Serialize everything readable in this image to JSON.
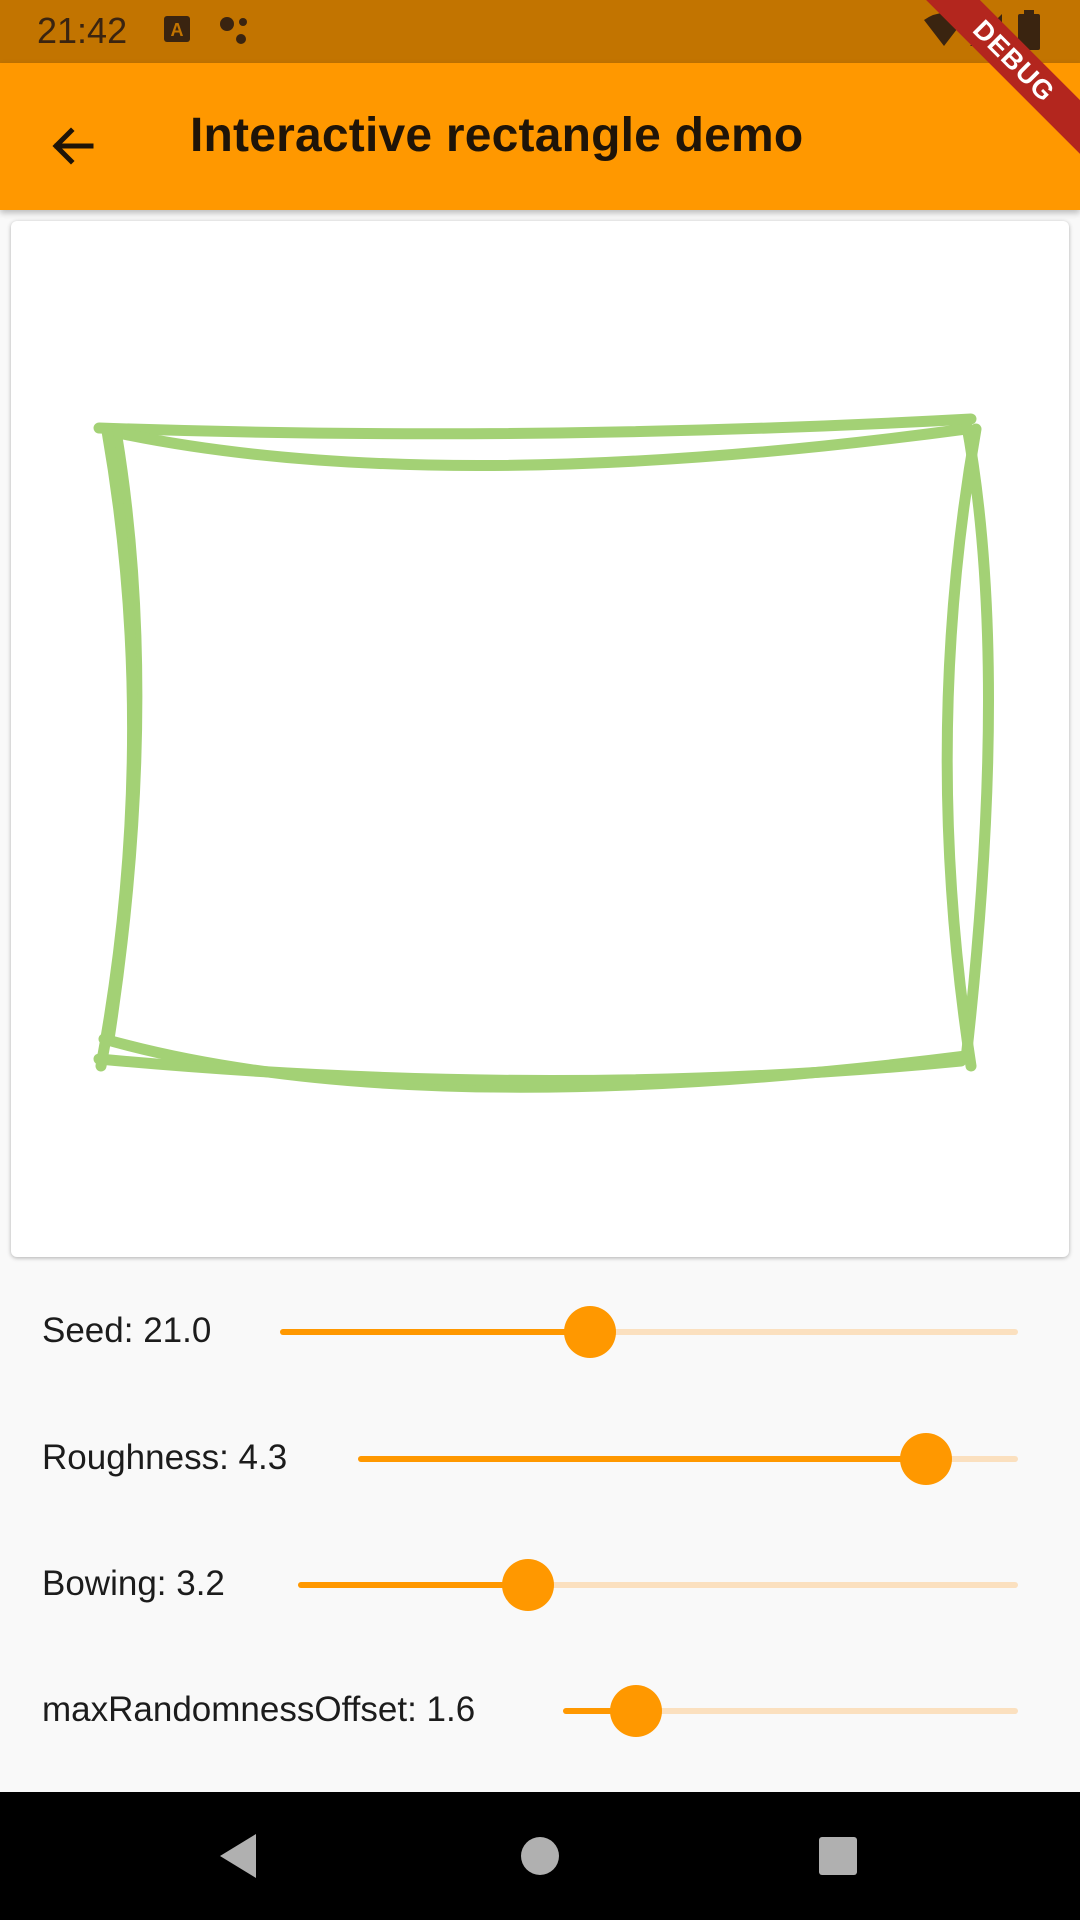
{
  "status_bar": {
    "time": "21:42",
    "icons": [
      "app-a-icon",
      "dots-icon",
      "wifi-icon",
      "signal-icon",
      "battery-icon"
    ]
  },
  "app_bar": {
    "title": "Interactive rectangle demo",
    "back_icon": "arrow-left-icon",
    "debug_label": "DEBUG",
    "color": "#ff9800"
  },
  "canvas": {
    "stroke_color": "#a3d175"
  },
  "controls": {
    "seed": {
      "label": "Seed: 21.0",
      "value": 21.0,
      "fraction": 0.42
    },
    "roughness": {
      "label": "Roughness: 4.3",
      "value": 4.3,
      "fraction": 0.86
    },
    "bowing": {
      "label": "Bowing: 3.2",
      "value": 3.2,
      "fraction": 0.32
    },
    "max_randomness_offset": {
      "label": "maxRandomnessOffset: 1.6",
      "value": 1.6,
      "fraction": 0.16
    }
  },
  "nav_bar": {
    "buttons": [
      "back-triangle-icon",
      "home-circle-icon",
      "recents-square-icon"
    ]
  },
  "colors": {
    "accent": "#ff9800",
    "status_bar": "#c27400",
    "track_inactive": "#fbe0bf"
  }
}
